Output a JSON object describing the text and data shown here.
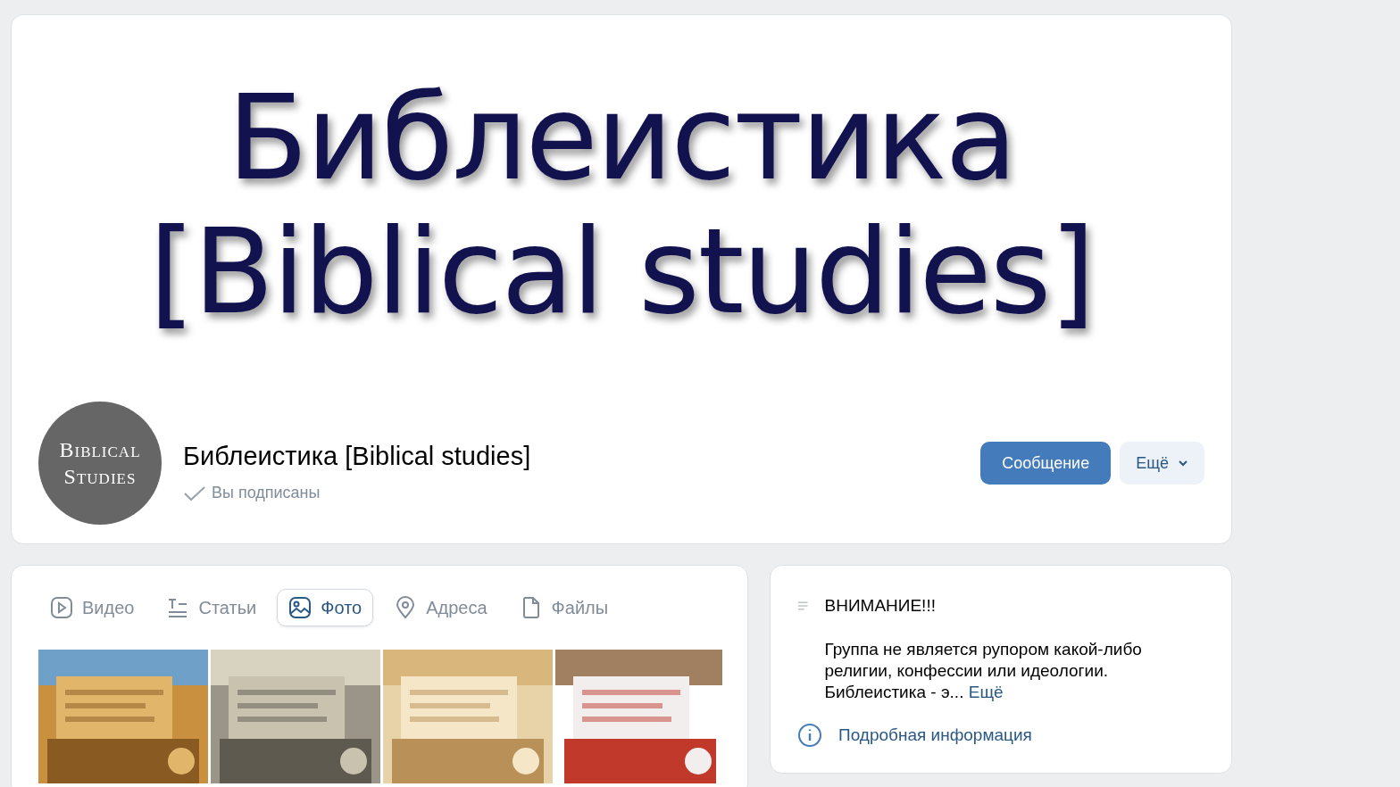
{
  "cover": {
    "lines": [
      "Библеистика",
      "[Biblical studies]"
    ]
  },
  "avatar": {
    "lines": [
      "Biblical",
      "Studies"
    ]
  },
  "group": {
    "name": "Библеистика [Biblical studies]",
    "subscribed": true,
    "subscribed_label": "Вы подписаны"
  },
  "actions": [
    {
      "kind": "primary",
      "label": "Сообщение"
    },
    {
      "kind": "more",
      "label": "Ещё"
    }
  ],
  "tabs": [
    {
      "label": "Видео",
      "kind": "video",
      "selected": false
    },
    {
      "label": "Статьи",
      "kind": "articles",
      "selected": false
    },
    {
      "label": "Фото",
      "selected": true
    },
    {
      "label": "Адреса",
      "kind": "pin",
      "selected": false
    },
    {
      "label": "Файлы",
      "kind": "file",
      "selected": false
    }
  ],
  "about": {
    "title": "ВНИМАНИЕ!!!",
    "text": "Группа не является рупором какой-либо религии, конфессии или идеологии. Библеистика - э...",
    "more": "Ещё",
    "details_link": "Подробная информация"
  }
}
